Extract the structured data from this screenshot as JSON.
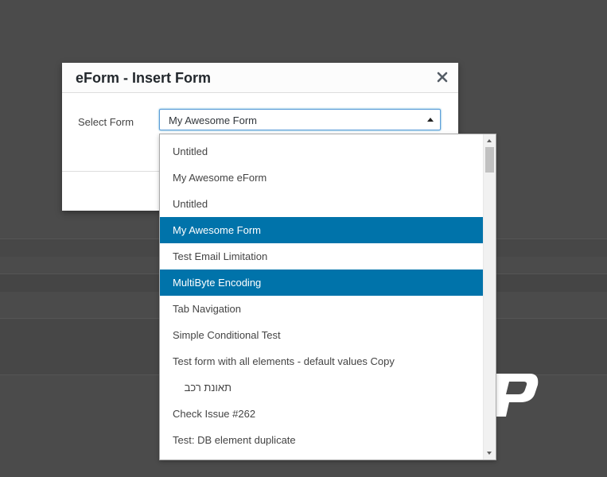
{
  "modal": {
    "title": "eForm - Insert Form",
    "close_label": "×",
    "field_label": "Select Form",
    "selected_value": "My Awesome Form"
  },
  "dropdown": {
    "options": [
      {
        "label": "Untitled",
        "state": "normal"
      },
      {
        "label": "My Awesome eForm",
        "state": "normal"
      },
      {
        "label": "Untitled",
        "state": "normal"
      },
      {
        "label": "My Awesome Form",
        "state": "selected"
      },
      {
        "label": "Test Email Limitation",
        "state": "normal"
      },
      {
        "label": "MultiByte Encoding",
        "state": "hovered"
      },
      {
        "label": "Tab Navigation",
        "state": "normal"
      },
      {
        "label": "Simple Conditional Test",
        "state": "normal"
      },
      {
        "label": "Test form with all elements - default values Copy",
        "state": "normal"
      },
      {
        "label": "תאונת רכב",
        "state": "normal"
      },
      {
        "label": "Check Issue #262",
        "state": "normal"
      },
      {
        "label": "Test: DB element duplicate",
        "state": "normal"
      }
    ]
  },
  "colors": {
    "highlight": "#0073aa",
    "backdrop": "#4b4b4b",
    "focus_border": "#5b9dd9"
  },
  "icons": {
    "close": "close-icon",
    "select_arrow": "chevron-up-icon",
    "logo": "brand-logo-icon"
  }
}
